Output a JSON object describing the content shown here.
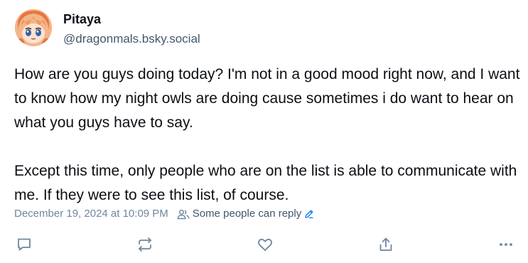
{
  "post": {
    "author": {
      "display_name": "Pitaya",
      "handle": "@dragonmals.bsky.social",
      "avatar_icon": "anime-avatar"
    },
    "text": "How are you guys doing today? I'm not in a good mood right now, and I want to know how my night owls are doing cause sometimes i do want to hear on what you guys have to say.\n\nExcept this time, only people who are on the list is able to communicate with me. If they were to see this list, of course.",
    "timestamp": "December 19, 2024 at 10:09 PM",
    "reply_settings": {
      "label": "Some people can reply",
      "icon": "people-icon",
      "edit_icon": "pencil-icon"
    },
    "actions": [
      {
        "icon": "reply-icon"
      },
      {
        "icon": "repost-icon"
      },
      {
        "icon": "like-icon"
      },
      {
        "icon": "share-icon"
      },
      {
        "icon": "more-icon"
      }
    ]
  },
  "colors": {
    "text": "#0b0f14",
    "muted": "#6f869f",
    "accent": "#1083fe",
    "icon": "#6f869f"
  }
}
